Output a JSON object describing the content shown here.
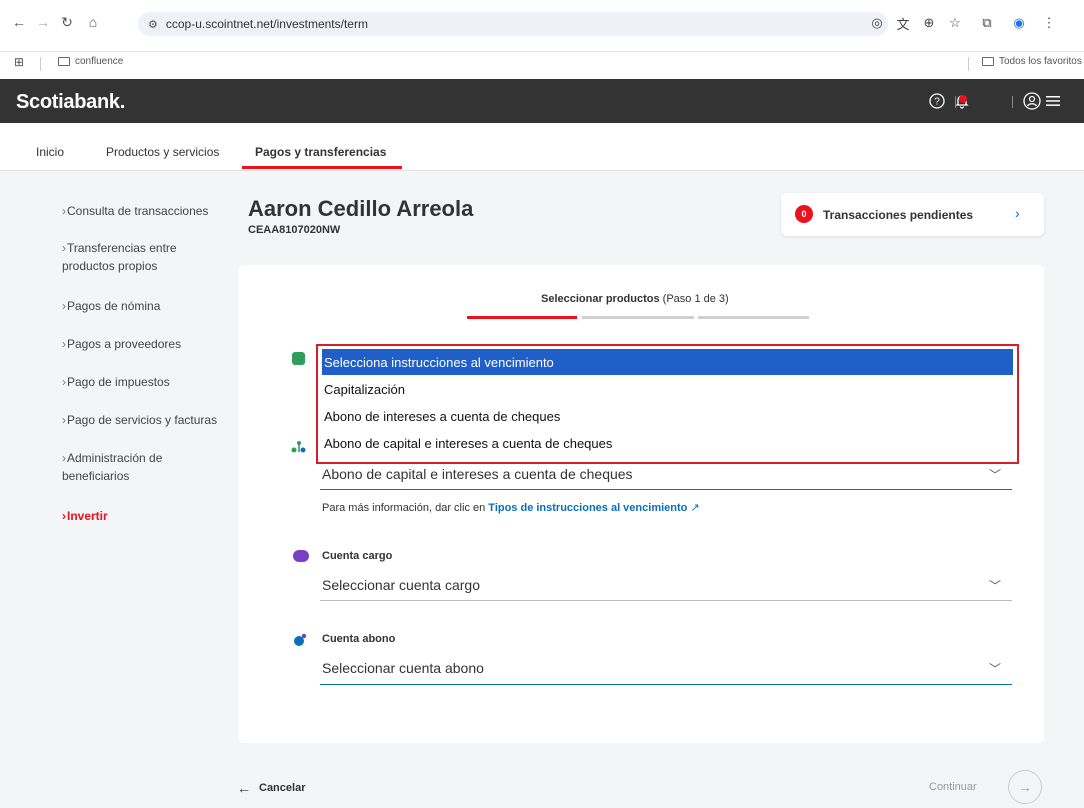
{
  "browser": {
    "url": "ccop-u.scointnet.net/investments/term",
    "bookmark_folder": "confluence",
    "all_bookmarks": "Todos los favoritos"
  },
  "header": {
    "logo": "Scotiabank."
  },
  "mainnav": {
    "items": [
      "Inicio",
      "Productos y servicios",
      "Pagos y transferencias"
    ],
    "active": "Pagos y transferencias"
  },
  "sidebar": {
    "items": [
      {
        "label": "Consulta de transacciones"
      },
      {
        "label": "Transferencias entre productos propios"
      },
      {
        "label": "Pagos de nómina"
      },
      {
        "label": "Pagos a proveedores"
      },
      {
        "label": "Pago de impuestos"
      },
      {
        "label": "Pago de servicios y facturas"
      },
      {
        "label": "Administración de beneficiarios"
      },
      {
        "label": "Invertir"
      }
    ],
    "active": "Invertir"
  },
  "user": {
    "name": "Aaron Cedillo Arreola",
    "id": "CEAA8107020NW"
  },
  "pending": {
    "count": "0",
    "label": "Transacciones pendientes"
  },
  "stepper": {
    "title": "Seleccionar productos",
    "step": "(Paso 1 de 3)",
    "steps_total": 3,
    "current_step": 1
  },
  "form": {
    "instructions_dropdown": {
      "options": [
        "Selecciona instrucciones al vencimiento",
        "Capitalización",
        "Abono de intereses a cuenta de cheques",
        "Abono de capital e intereses a cuenta de cheques"
      ],
      "highlighted": "Selecciona instrucciones al vencimiento"
    },
    "instructions_value": "Abono de capital e intereses a cuenta de cheques",
    "info_prefix": "Para más información, dar clic en ",
    "info_link": "Tipos de instrucciones al vencimiento",
    "cargo_label": "Cuenta cargo",
    "cargo_placeholder": "Seleccionar cuenta cargo",
    "abono_label": "Cuenta abono",
    "abono_placeholder": "Seleccionar cuenta abono"
  },
  "footer": {
    "cancel": "Cancelar",
    "continue": "Continuar"
  },
  "colors": {
    "brand_red": "#ec111a",
    "header_dark": "#333333",
    "link_blue": "#0a6fb7",
    "selection_blue": "#1f5fc7"
  }
}
